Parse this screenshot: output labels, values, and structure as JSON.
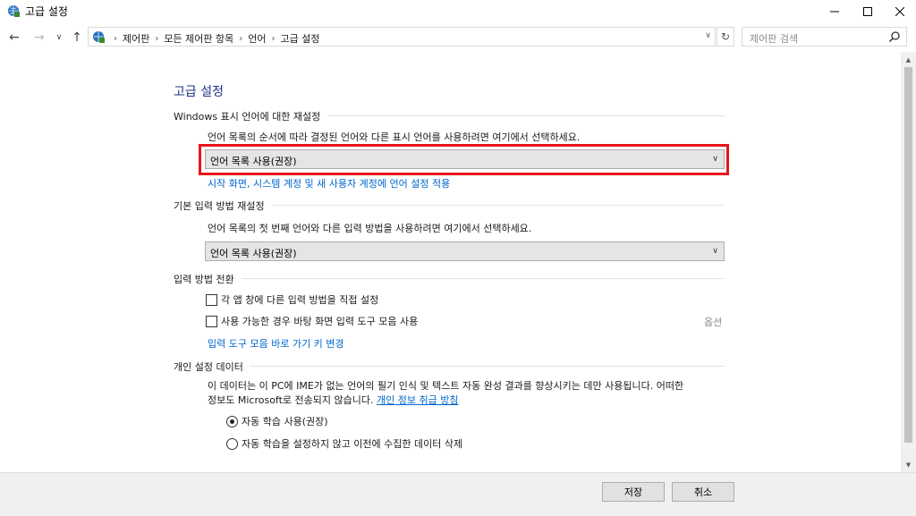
{
  "window": {
    "title": "고급 설정"
  },
  "navigation": {
    "breadcrumbs": [
      "제어판",
      "모든 제어판 항목",
      "언어",
      "고급 설정"
    ],
    "search_placeholder": "제어판 검색"
  },
  "page": {
    "title": "고급 설정"
  },
  "display_language": {
    "heading": "Windows 표시 언어에 대한 재설정",
    "description": "언어 목록의 순서에 따라 결정된 언어와 다른 표시 언어를 사용하려면 여기에서 선택하세요.",
    "selected": "언어 목록 사용(권장)",
    "apply_link": "시작 화면, 시스템 계정 및 새 사용자 계정에 언어 설정 적용"
  },
  "input_method": {
    "heading": "기본 입력 방법 재설정",
    "description": "언어 목록의 첫 번째 언어와 다른 입력 방법을 사용하려면 여기에서 선택하세요.",
    "selected": "언어 목록 사용(권장)"
  },
  "switching": {
    "heading": "입력 방법 전환",
    "per_app_label": "각 앱 창에 다른 입력 방법을 직접 설정",
    "per_app_checked": false,
    "desktop_bar_label": "사용 가능한 경우 바탕 화면 입력 도구 모음 사용",
    "desktop_bar_checked": false,
    "options_label": "옵션",
    "hotkeys_link": "입력 도구 모음 바로 가기 키 변경"
  },
  "personalization": {
    "heading": "개인 설정 데이터",
    "description_line1": "이 데이터는 이 PC에 IME가 없는 언어의 필기 인식 및 텍스트 자동 완성 결과를 향상시키는 데만 사용됩니다. 어떠한",
    "description_line2": "정보도 Microsoft로 전송되지 않습니다.",
    "privacy_link": "개인 정보 취급 방침",
    "auto_learn_label": "자동 학습 사용(권장)",
    "auto_learn_selected": true,
    "no_learn_label": "자동 학습을 설정하지 않고 이전에 수집한 데이터 삭제",
    "no_learn_selected": false
  },
  "buttons": {
    "save": "저장",
    "cancel": "취소"
  },
  "colors": {
    "title_blue": "#1e3287",
    "link_blue": "#0066cc",
    "highlight_red": "#e8141c"
  },
  "icons": [
    "control-panel-icon",
    "back-icon",
    "forward-icon",
    "up-icon",
    "refresh-icon",
    "search-icon"
  ]
}
